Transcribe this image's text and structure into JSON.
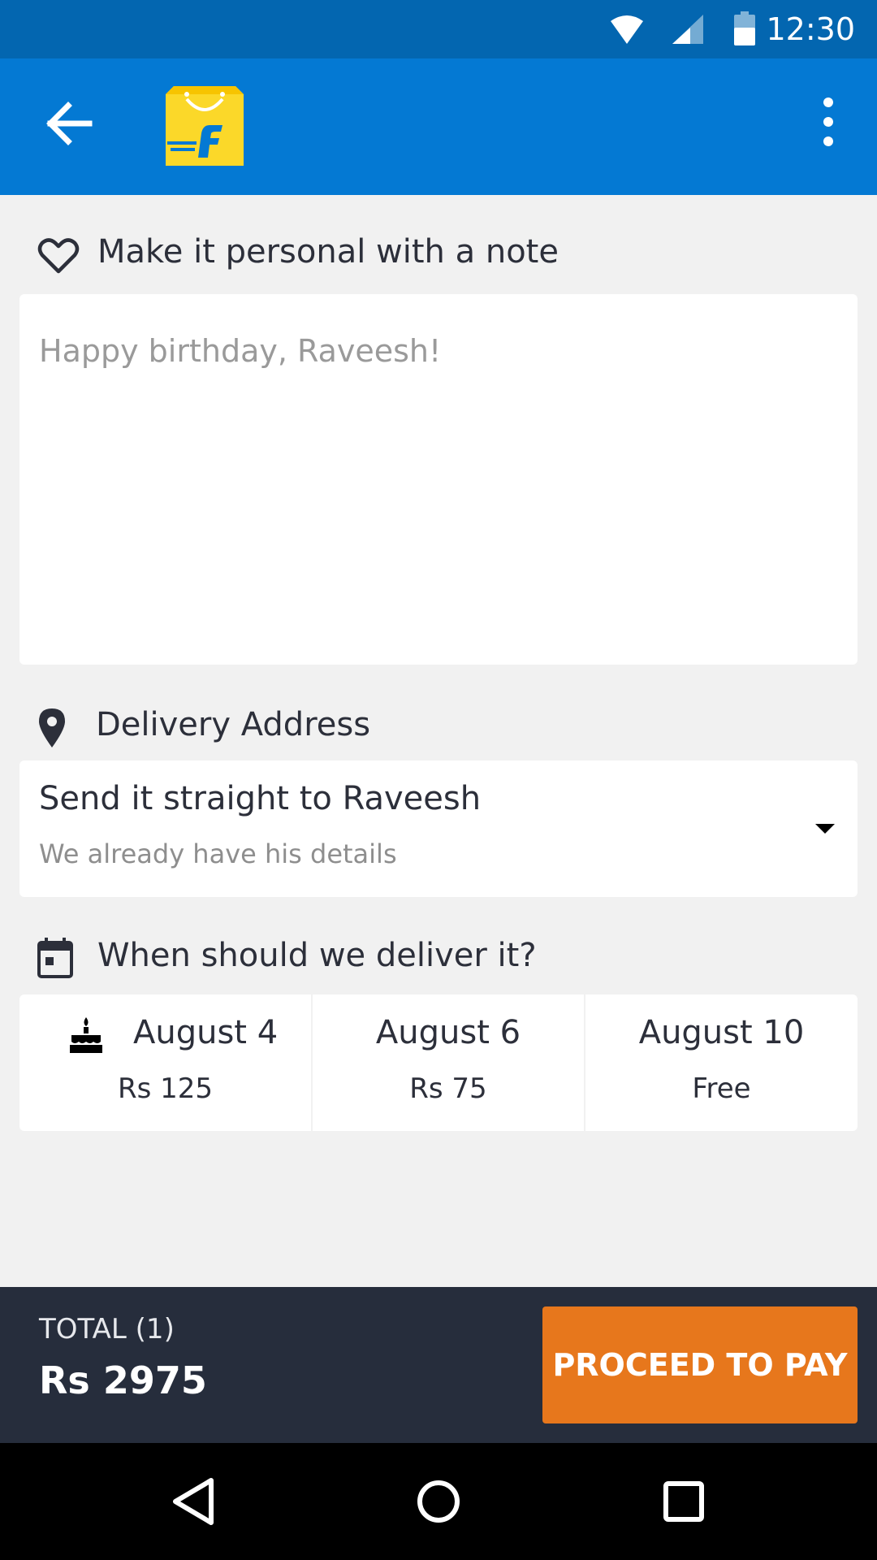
{
  "status_bar": {
    "time": "12:30"
  },
  "note": {
    "heading": "Make it personal with a note",
    "placeholder": "Happy birthday, Raveesh!"
  },
  "address": {
    "heading": "Delivery Address",
    "selected": "Send it straight to Raveesh",
    "hint": "We already have his details"
  },
  "delivery": {
    "heading": "When should we deliver it?",
    "options": [
      {
        "date": "August 4",
        "price": "Rs 125"
      },
      {
        "date": "August 6",
        "price": "Rs 75"
      },
      {
        "date": "August 10",
        "price": "Free"
      }
    ]
  },
  "footer": {
    "total_label": "TOTAL (1)",
    "total_value": "Rs 2975",
    "pay_label": "PROCEED TO PAY"
  },
  "colors": {
    "status_bar": "#0366b0",
    "app_bar": "#0479d3",
    "footer": "#262d3c",
    "accent": "#e7771c",
    "logo": "#fbd829"
  }
}
